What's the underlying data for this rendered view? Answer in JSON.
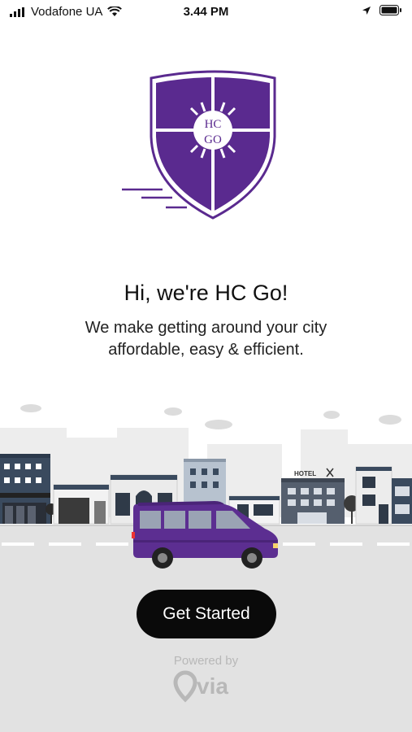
{
  "status_bar": {
    "carrier": "Vodafone UA",
    "time": "3.44 PM",
    "icons": [
      "signal-icon",
      "wifi-icon",
      "location-arrow-icon",
      "battery-icon"
    ]
  },
  "logo": {
    "text_top": "HC",
    "text_bottom": "GO"
  },
  "headline": "Hi, we're HC Go!",
  "subtext_line1": "We make getting around your city",
  "subtext_line2": "affordable, easy & efficient.",
  "city": {
    "hotel_sign": "HOTEL"
  },
  "cta": {
    "label": "Get Started"
  },
  "footer": {
    "powered_by": "Powered by",
    "brand": "via"
  },
  "colors": {
    "brand_purple": "#5a2a8f",
    "van_purple": "#5c2e91",
    "cta_bg": "#0a0a0a",
    "road": "#e2e2e2"
  }
}
